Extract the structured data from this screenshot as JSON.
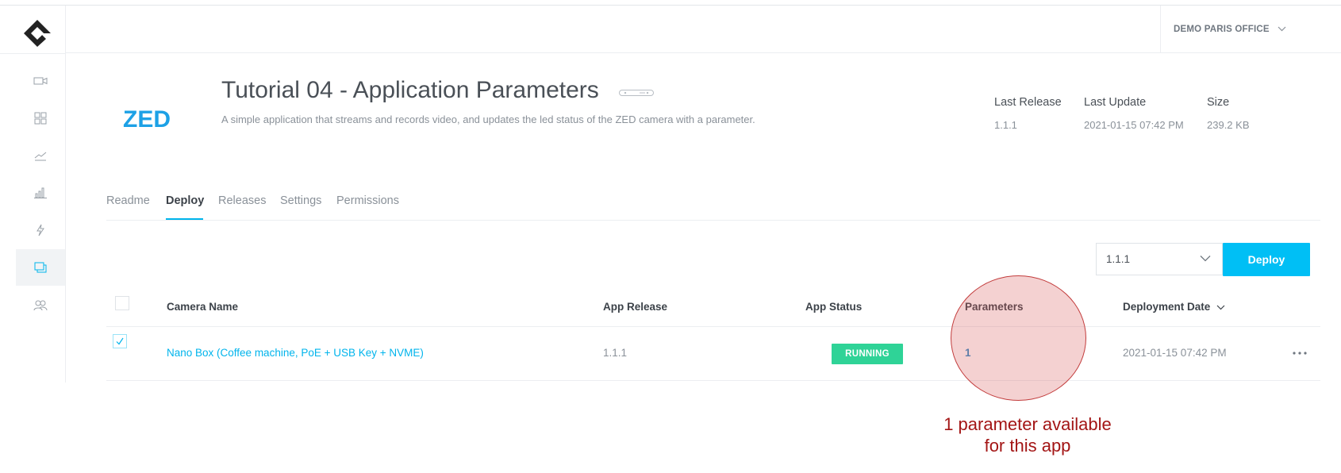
{
  "header": {
    "org_name": "DEMO PARIS OFFICE"
  },
  "sidebar": {
    "items": [
      {
        "icon": "video-camera-icon"
      },
      {
        "icon": "grid-icon"
      },
      {
        "icon": "trend-line-icon"
      },
      {
        "icon": "bar-chart-icon"
      },
      {
        "icon": "bolt-icon"
      },
      {
        "icon": "apps-icon",
        "active": true
      },
      {
        "icon": "users-icon"
      }
    ]
  },
  "app": {
    "logo_text": "ZED",
    "title": "Tutorial 04 - Application Parameters",
    "description": "A simple application that streams and records video, and updates the led status of the ZED camera with a parameter.",
    "meta": {
      "last_release_label": "Last Release",
      "last_release_value": "1.1.1",
      "last_update_label": "Last Update",
      "last_update_value": "2021-01-15 07:42 PM",
      "size_label": "Size",
      "size_value": "239.2 KB"
    }
  },
  "tabs": [
    {
      "label": "Readme"
    },
    {
      "label": "Deploy",
      "active": true
    },
    {
      "label": "Releases"
    },
    {
      "label": "Settings"
    },
    {
      "label": "Permissions"
    }
  ],
  "deploy": {
    "selected_version": "1.1.1",
    "button_label": "Deploy"
  },
  "table": {
    "columns": {
      "camera_name": "Camera Name",
      "app_release": "App Release",
      "app_status": "App Status",
      "parameters": "Parameters",
      "deployment_date": "Deployment Date"
    },
    "rows": [
      {
        "checked": true,
        "camera_name": "Nano Box (Coffee machine, PoE + USB Key + NVME)",
        "app_release": "1.1.1",
        "app_status": "RUNNING",
        "parameters": "1",
        "deployment_date": "2021-01-15 07:42 PM"
      }
    ]
  },
  "annotation": {
    "line1": "1 parameter available",
    "line2": "for this app"
  },
  "colors": {
    "accent": "#00bff5",
    "status_running": "#2fd397",
    "annotation": "#a31515"
  }
}
